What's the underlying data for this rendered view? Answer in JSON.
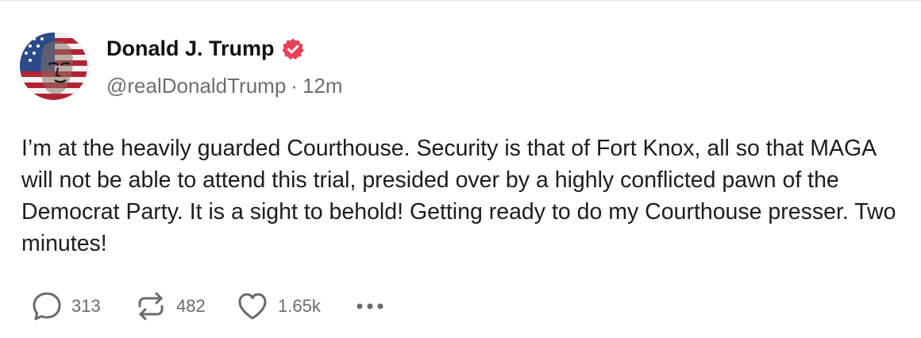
{
  "post": {
    "author": {
      "name": "Donald J. Trump",
      "handle": "@realDonaldTrump",
      "verified": true,
      "avatar_icon": "flag-portrait-avatar"
    },
    "separator": "·",
    "time_ago": "12m",
    "text": "I’m at the heavily guarded Courthouse. Security is that of Fort Knox, all so that MAGA will not be able to attend this trial, presided over by a highly conflicted pawn of the Democrat Party. It is a sight to behold! Getting ready to do my Courthouse presser. Two minutes!",
    "stats": {
      "replies": "313",
      "reposts": "482",
      "likes": "1.65k"
    }
  },
  "colors": {
    "verified_badge": "#e8405a",
    "icon_gray": "#6a6a6a",
    "name_text": "#111111",
    "meta_text": "#6e6e6e"
  }
}
